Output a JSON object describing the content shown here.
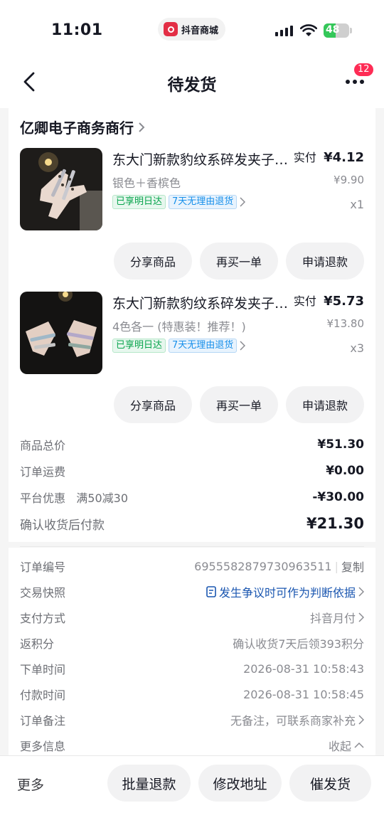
{
  "status": {
    "time": "11:01",
    "app_name": "抖音商城",
    "battery": "48",
    "battery_level": 0.48
  },
  "nav": {
    "title": "待发货",
    "badge": "12"
  },
  "shop": {
    "name": "亿卿电子商务商行"
  },
  "items": [
    {
      "title": "东大门新款豹纹系碎发夹子女网红发夹",
      "spec": "银色＋香槟色",
      "tags": [
        "已享明日达",
        "7天无理由退货"
      ],
      "paid_label": "实付",
      "paid_price": "¥4.12",
      "original_price": "¥9.90",
      "quantity": "x1",
      "buttons": [
        "分享商品",
        "再买一单",
        "申请退款"
      ]
    },
    {
      "title": "东大门新款豹纹系碎发夹子女网红发夹",
      "spec": "4色各一 (特惠装！推荐！)",
      "tags": [
        "已享明日达",
        "7天无理由退货"
      ],
      "paid_label": "实付",
      "paid_price": "¥5.73",
      "original_price": "¥13.80",
      "quantity": "x3",
      "buttons": [
        "分享商品",
        "再买一单",
        "申请退款"
      ]
    }
  ],
  "summary": {
    "goods_total_label": "商品总价",
    "goods_total": "¥51.30",
    "shipping_label": "订单运费",
    "shipping": "¥0.00",
    "discount_label": "平台优惠",
    "discount_note": "满50减30",
    "discount": "-¥30.00",
    "pay_label": "确认收货后付款",
    "pay": "¥21.30"
  },
  "info": {
    "order_no_label": "订单编号",
    "order_no": "6955582879730963511",
    "copy": "复制",
    "snapshot_label": "交易快照",
    "snapshot": "发生争议时可作为判断依据",
    "payment_label": "支付方式",
    "payment": "抖音月付",
    "points_label": "返积分",
    "points": "确认收货7天后领393积分",
    "order_time_label": "下单时间",
    "order_time": "2026-08-31 10:58:43",
    "pay_time_label": "付款时间",
    "pay_time": "2026-08-31 10:58:45",
    "remark_label": "订单备注",
    "remark": "无备注，可联系商家补充",
    "more_label": "更多信息",
    "collapse": "收起"
  },
  "bottom": {
    "more": "更多",
    "buttons": [
      "批量退款",
      "修改地址",
      "催发货"
    ]
  }
}
